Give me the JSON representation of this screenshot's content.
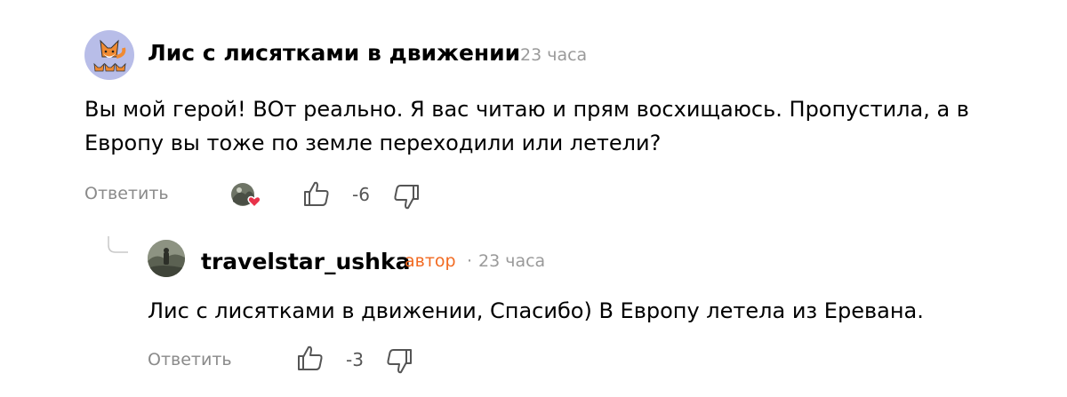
{
  "comment": {
    "author": "Лис с лисятками в движении",
    "time": "23 часа",
    "text_line1": "Вы мой герой! ВОт реально. Я вас читаю и прям восхищаюсь. Пропустила, а в",
    "text_line2": "Европу вы тоже по земле переходили или летели?",
    "reply_label": "Ответить",
    "rating": "-6",
    "avatar_icon": "fox-avatar-icon",
    "liked_by_icon": "liked-by-author-avatar-heart-icon"
  },
  "reply_comment": {
    "author": "travelstar_ushka",
    "author_badge": "автор",
    "separator": "·",
    "time": "23 часа",
    "text": "Лис с лисятками в движении, Спасибо) В Европу летела из Еревана.",
    "reply_label": "Ответить",
    "rating": "-3",
    "avatar_icon": "traveler-photo-avatar"
  },
  "colors": {
    "accent": "#f26a21",
    "muted": "#9a9a9a",
    "heart": "#e8334a",
    "icon_stroke": "#555555"
  }
}
